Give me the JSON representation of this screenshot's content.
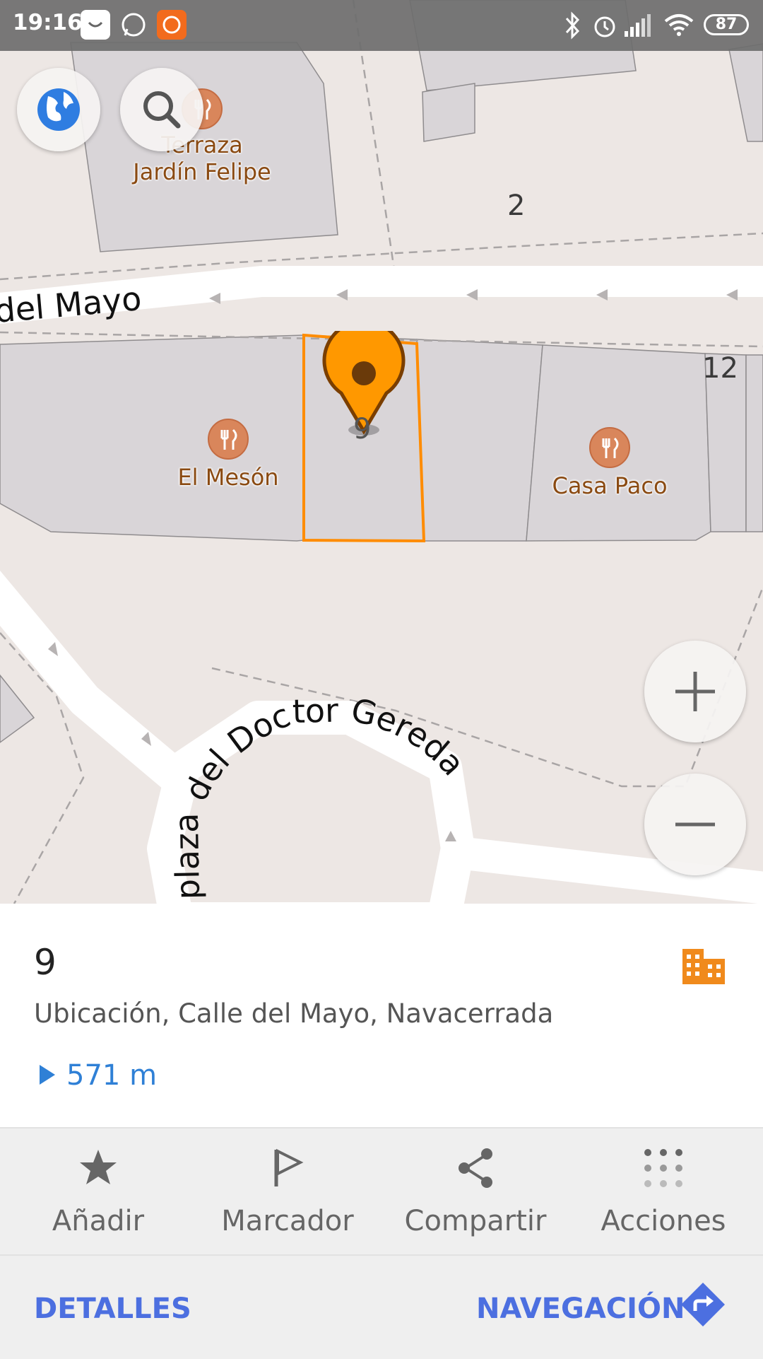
{
  "status_bar": {
    "time": "19:16",
    "battery": "87",
    "icons": [
      "app-store-icon",
      "whatsapp-icon",
      "mi-app-icon",
      "bluetooth-icon",
      "alarm-icon",
      "signal-icon",
      "wifi-icon",
      "battery-icon"
    ]
  },
  "map": {
    "streets": {
      "calle_mayo": "del Mayo",
      "plaza": "plaza del Doctor Gereda"
    },
    "pois": [
      {
        "name_line1": "Terraza",
        "name_line2": "Jardín Felipe",
        "icon": "restaurant-icon"
      },
      {
        "name_line1": "El Mesón",
        "name_line2": "",
        "icon": "restaurant-icon"
      },
      {
        "name_line1": "Casa Paco",
        "name_line2": "",
        "icon": "restaurant-icon"
      }
    ],
    "house_numbers": [
      "2",
      "12"
    ],
    "marker_color": "#ff9800",
    "selection_color": "#ff8c00",
    "zoom_buttons": {
      "in": "+",
      "out": "−"
    }
  },
  "place": {
    "title": "9",
    "subtitle": "Ubicación, Calle del Mayo, Navacerrada",
    "distance": "571 m",
    "type_icon": "building-icon"
  },
  "actions": [
    {
      "label": "Añadir",
      "icon": "star-icon"
    },
    {
      "label": "Marcador",
      "icon": "flag-icon"
    },
    {
      "label": "Compartir",
      "icon": "share-icon"
    },
    {
      "label": "Acciones",
      "icon": "grid-dots-icon"
    }
  ],
  "footer": {
    "details": "DETALLES",
    "navigation": "NAVEGACIÓN"
  },
  "colors": {
    "accent": "#4c6fe0",
    "distance": "#2f80d6",
    "building": "#f08a1c",
    "map_bg": "#ede7e4",
    "building_fill": "#d9d5d8"
  }
}
